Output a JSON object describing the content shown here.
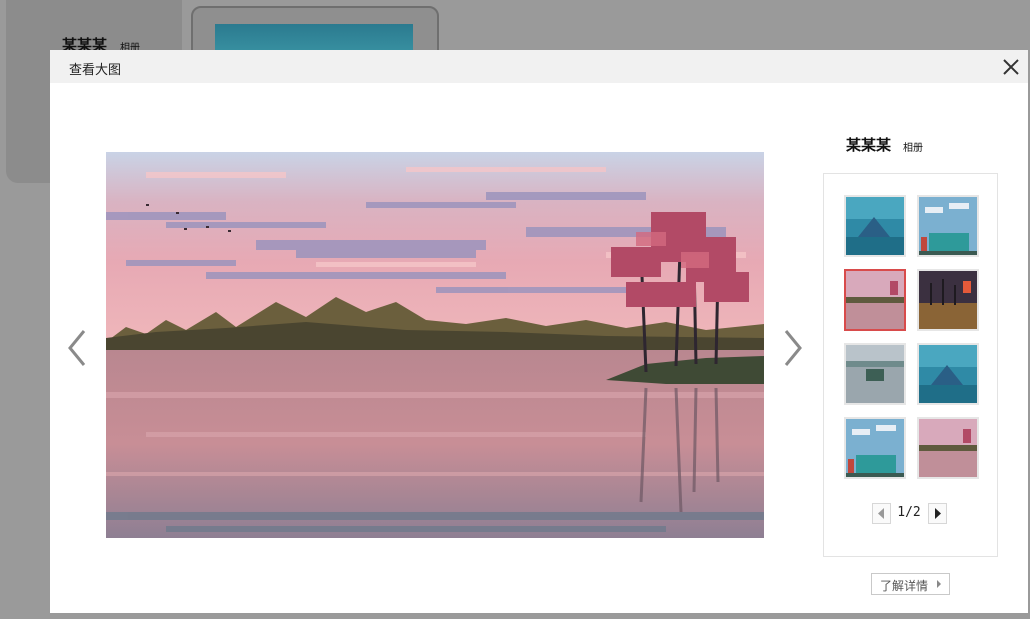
{
  "background": {
    "album_owner": "某某某",
    "album_label": "相册"
  },
  "modal": {
    "title": "查看大图",
    "close_icon": "close-icon"
  },
  "navigation": {
    "prev_icon": "chevron-left-icon",
    "next_icon": "chevron-right-icon"
  },
  "sidebar": {
    "album_owner": "某某某",
    "album_label": "相册",
    "thumbnails": [
      {
        "name": "mountain-lake",
        "selected": false
      },
      {
        "name": "teal-house-clouds",
        "selected": false
      },
      {
        "name": "pink-lake-trees",
        "selected": true
      },
      {
        "name": "palm-sunset",
        "selected": false
      },
      {
        "name": "car-misty-lake",
        "selected": false
      },
      {
        "name": "mountain-lake",
        "selected": false
      },
      {
        "name": "teal-house-clouds",
        "selected": false
      },
      {
        "name": "pink-lake-trees",
        "selected": false
      }
    ],
    "pager": {
      "text": "1/2",
      "prev_icon": "triangle-left-icon",
      "next_icon": "triangle-right-icon"
    },
    "more_button": "了解详情"
  },
  "colors": {
    "accent_selected": "#d84b4b",
    "overlay": "#9a9a9a"
  }
}
